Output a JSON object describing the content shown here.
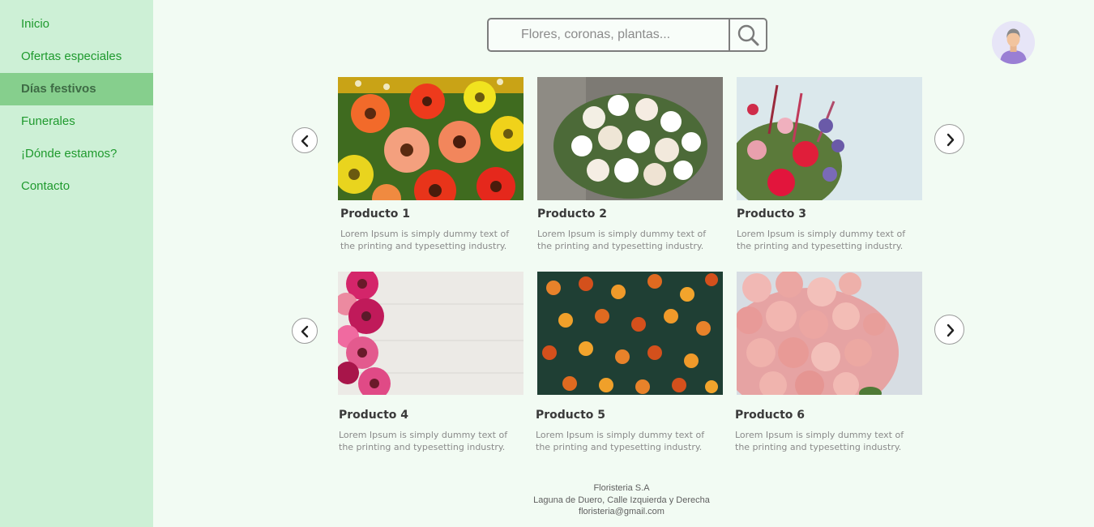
{
  "sidebar": {
    "items": [
      {
        "label": "Inicio",
        "active": false
      },
      {
        "label": "Ofertas especiales",
        "active": false
      },
      {
        "label": "Días festivos",
        "active": true
      },
      {
        "label": "Funerales",
        "active": false
      },
      {
        "label": "¡Dónde estamos?",
        "active": false
      },
      {
        "label": "Contacto",
        "active": false
      }
    ]
  },
  "search": {
    "placeholder": "Flores, coronas, plantas...",
    "value": "",
    "icon": "search-icon"
  },
  "avatar": {
    "icon": "user-avatar-icon"
  },
  "carousel": {
    "prev_icon": "chevron-left-icon",
    "next_icon": "chevron-right-icon"
  },
  "products": [
    {
      "title": "Producto 1",
      "desc": "Lorem Ipsum is simply dummy text of the printing and typesetting industry.",
      "image": "gerbera-mix-photo"
    },
    {
      "title": "Producto 2",
      "desc": "Lorem Ipsum is simply dummy text of the printing and typesetting industry.",
      "image": "white-roses-bouquet-photo"
    },
    {
      "title": "Producto 3",
      "desc": "Lorem Ipsum is simply dummy text of the printing and typesetting industry.",
      "image": "mixed-bouquet-photo"
    },
    {
      "title": "Producto 4",
      "desc": "Lorem Ipsum is simply dummy text of the printing and typesetting industry.",
      "image": "pink-gerberas-on-wood-photo"
    },
    {
      "title": "Producto 5",
      "desc": "Lorem Ipsum is simply dummy text of the printing and typesetting industry.",
      "image": "orange-zinnias-photo"
    },
    {
      "title": "Producto 6",
      "desc": "Lorem Ipsum is simply dummy text of the printing and typesetting industry.",
      "image": "pink-roses-photo"
    }
  ],
  "footer": {
    "company": "Floristeria S.A",
    "address": "Laguna de Duero, Calle Izquierda y Derecha",
    "email": "floristeria@gmail.com"
  },
  "colors": {
    "sidebar_bg": "#cdf0d6",
    "sidebar_active_bg": "#86cf8d",
    "link_green": "#1f9a2e",
    "page_bg": "#f2fbf3"
  }
}
